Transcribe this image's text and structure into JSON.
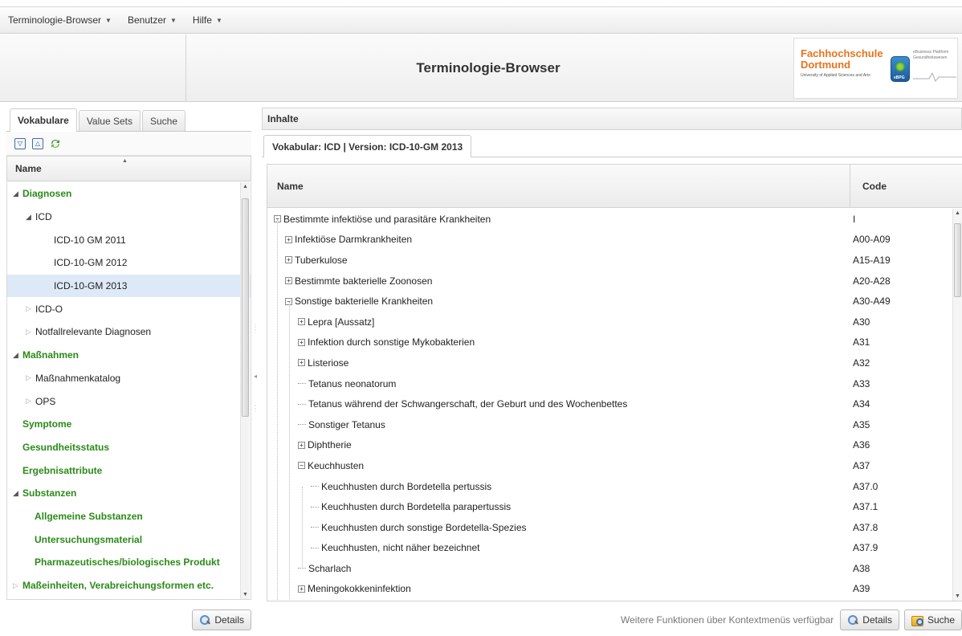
{
  "menu": [
    "Terminologie-Browser",
    "Benutzer",
    "Hilfe"
  ],
  "header": {
    "title": "Terminologie-Browser",
    "logo": {
      "line1": "Fachhochschule",
      "line2": "Dortmund",
      "subtitle": "University of Applied Sciences and Arts",
      "ebpg": "eBPG",
      "eb_text": "eBusiness Plattform Gesundheitswesen"
    }
  },
  "left": {
    "tabs": [
      "Vokabulare",
      "Value Sets",
      "Suche"
    ],
    "toolbar_icons": [
      "expand-all-icon",
      "collapse-all-icon",
      "refresh-icon"
    ],
    "column": "Name",
    "tree": [
      {
        "label": "Diagnosen",
        "level": 0,
        "state": "open",
        "green": true
      },
      {
        "label": "ICD",
        "level": 1,
        "state": "open"
      },
      {
        "label": "ICD-10 GM 2011",
        "level": 2,
        "state": "none"
      },
      {
        "label": "ICD-10-GM 2012",
        "level": 2,
        "state": "none"
      },
      {
        "label": "ICD-10-GM 2013",
        "level": 2,
        "state": "none",
        "selected": true
      },
      {
        "label": "ICD-O",
        "level": 1,
        "state": "closed"
      },
      {
        "label": "Notfallrelevante Diagnosen",
        "level": 1,
        "state": "closed"
      },
      {
        "label": "Maßnahmen",
        "level": 0,
        "state": "open",
        "green": true
      },
      {
        "label": "Maßnahmenkatalog",
        "level": 1,
        "state": "closed"
      },
      {
        "label": "OPS",
        "level": 1,
        "state": "closed"
      },
      {
        "label": "Symptome",
        "level": 0,
        "state": "none",
        "green": true
      },
      {
        "label": "Gesundheitsstatus",
        "level": 0,
        "state": "none",
        "green": true
      },
      {
        "label": "Ergebnisattribute",
        "level": 0,
        "state": "none",
        "green": true
      },
      {
        "label": "Substanzen",
        "level": 0,
        "state": "open",
        "green": true
      },
      {
        "label": "Allgemeine Substanzen",
        "level": 1,
        "state": "none",
        "green": true
      },
      {
        "label": "Untersuchungsmaterial",
        "level": 1,
        "state": "none",
        "green": true
      },
      {
        "label": "Pharmazeutisches/biologisches Produkt",
        "level": 1,
        "state": "none",
        "green": true
      },
      {
        "label": "Maßeinheiten, Verabreichungsformen etc.",
        "level": 0,
        "state": "closed",
        "green": true
      }
    ],
    "details_button": "Details"
  },
  "right": {
    "panel_title": "Inhalte",
    "tab": "Vokabular: ICD | Version: ICD-10-GM 2013",
    "columns": {
      "name": "Name",
      "code": "Code"
    },
    "rows": [
      {
        "name": "Bestimmte infektiöse und parasitäre Krankheiten",
        "code": "I",
        "level": 0,
        "type": "minus"
      },
      {
        "name": "Infektiöse Darmkrankheiten",
        "code": "A00-A09",
        "level": 1,
        "type": "plus"
      },
      {
        "name": "Tuberkulose",
        "code": "A15-A19",
        "level": 1,
        "type": "plus"
      },
      {
        "name": "Bestimmte bakterielle Zoonosen",
        "code": "A20-A28",
        "level": 1,
        "type": "plus"
      },
      {
        "name": "Sonstige bakterielle Krankheiten",
        "code": "A30-A49",
        "level": 1,
        "type": "minus"
      },
      {
        "name": "Lepra [Aussatz]",
        "code": "A30",
        "level": 2,
        "type": "plus"
      },
      {
        "name": "Infektion durch sonstige Mykobakterien",
        "code": "A31",
        "level": 2,
        "type": "plus"
      },
      {
        "name": "Listeriose",
        "code": "A32",
        "level": 2,
        "type": "plus"
      },
      {
        "name": "Tetanus neonatorum",
        "code": "A33",
        "level": 2,
        "type": "leaf"
      },
      {
        "name": "Tetanus während der Schwangerschaft, der Geburt und des Wochenbettes",
        "code": "A34",
        "level": 2,
        "type": "leaf"
      },
      {
        "name": "Sonstiger Tetanus",
        "code": "A35",
        "level": 2,
        "type": "leaf"
      },
      {
        "name": "Diphtherie",
        "code": "A36",
        "level": 2,
        "type": "plus"
      },
      {
        "name": "Keuchhusten",
        "code": "A37",
        "level": 2,
        "type": "minus"
      },
      {
        "name": "Keuchhusten durch Bordetella pertussis",
        "code": "A37.0",
        "level": 3,
        "type": "leaf"
      },
      {
        "name": "Keuchhusten durch Bordetella parapertussis",
        "code": "A37.1",
        "level": 3,
        "type": "leaf"
      },
      {
        "name": "Keuchhusten durch sonstige Bordetella-Spezies",
        "code": "A37.8",
        "level": 3,
        "type": "leaf"
      },
      {
        "name": "Keuchhusten, nicht näher bezeichnet",
        "code": "A37.9",
        "level": 3,
        "type": "leaf"
      },
      {
        "name": "Scharlach",
        "code": "A38",
        "level": 2,
        "type": "leaf"
      },
      {
        "name": "Meningokokkeninfektion",
        "code": "A39",
        "level": 2,
        "type": "plus"
      }
    ],
    "footer_note": "Weitere Funktionen über Kontextmenüs verfügbar",
    "details_button": "Details",
    "search_button": "Suche"
  }
}
